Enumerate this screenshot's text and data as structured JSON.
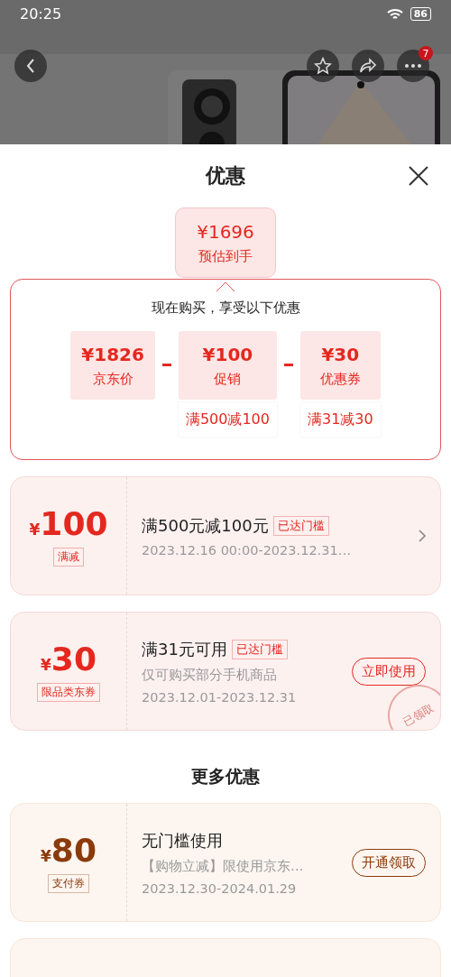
{
  "status_bar": {
    "time": "20:25",
    "battery": "86"
  },
  "nav": {
    "badge": "7"
  },
  "sheet": {
    "title": "优惠",
    "estimate": {
      "price": "¥1696",
      "label": "预估到手"
    },
    "breakdown": {
      "heading": "现在购买，享受以下优惠",
      "items": [
        {
          "amount": "¥1826",
          "label": "京东价"
        },
        {
          "amount": "¥100",
          "label": "促销",
          "note": "满500减100"
        },
        {
          "amount": "¥30",
          "label": "优惠券",
          "note": "满31减30"
        }
      ]
    },
    "coupons": [
      {
        "kind": "arrow",
        "color": "#e4281f",
        "currency": "¥",
        "amount": "100",
        "tag": "满减",
        "title": "满500元减100元",
        "badge": "已达门槛",
        "lines": [
          "2023.12.16 00:00-2023.12.31…"
        ]
      },
      {
        "kind": "button",
        "color": "#e4281f",
        "currency": "¥",
        "amount": "30",
        "tag": "限品类东券",
        "title": "满31元可用",
        "badge": "已达门槛",
        "lines": [
          "仅可购买部分手机商品",
          "2023.12.01-2023.12.31"
        ],
        "action": "立即使用",
        "stamp": "已领取"
      }
    ],
    "more_heading": "更多优惠",
    "more_coupons": [
      {
        "kind": "button",
        "color": "#8b3a0c",
        "currency": "¥",
        "amount": "80",
        "tag": "支付券",
        "title": "无门槛使用",
        "lines": [
          "【购物立减】限使用京东…",
          "2023.12.30-2024.01.29"
        ],
        "action": "开通领取"
      }
    ]
  }
}
